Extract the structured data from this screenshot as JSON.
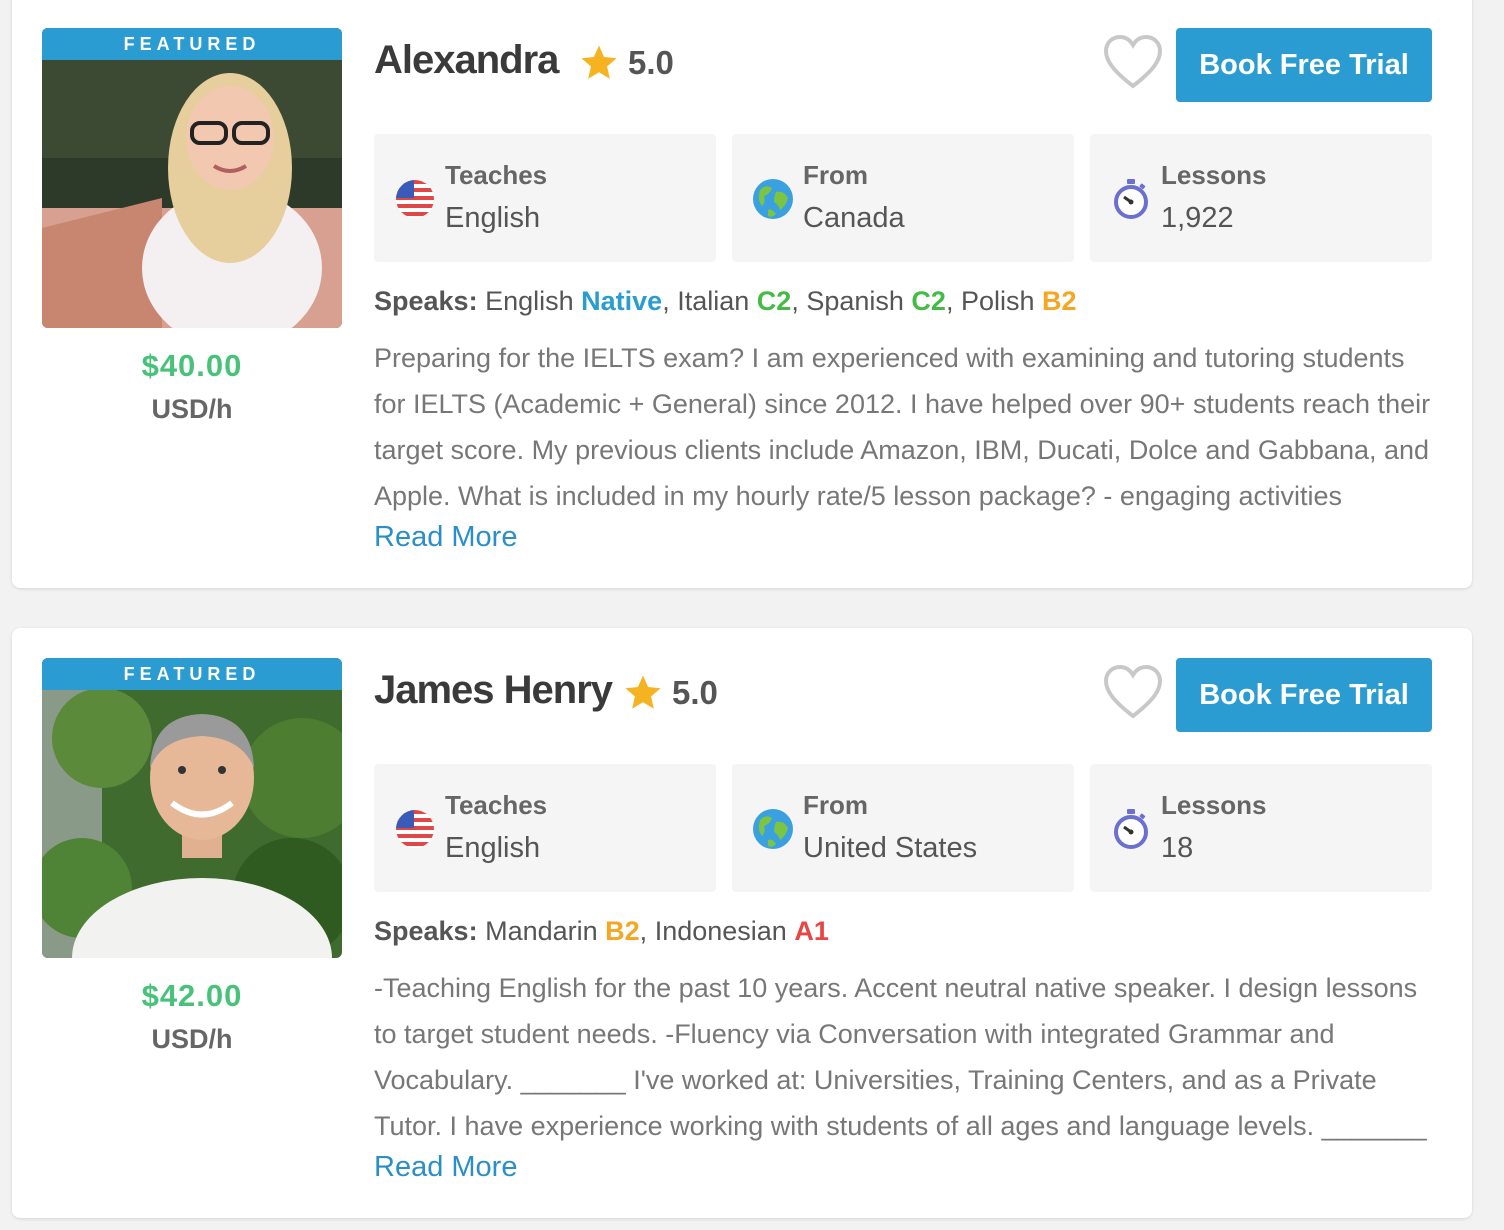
{
  "colors": {
    "accent": "#2a9cd1",
    "price_green": "#48c27a",
    "native": "#2a9cd1",
    "c2": "#44bb44",
    "b2": "#f5a623",
    "a1": "#e84545",
    "star": "#f5b321"
  },
  "icons": {
    "favorite": "heart-icon",
    "rating": "star-icon",
    "teaches": "us-flag-icon",
    "from": "globe-icon",
    "lessons": "stopwatch-icon"
  },
  "tutors": [
    {
      "badge": "FEATURED",
      "name": "Alexandra",
      "rating": "5.0",
      "book_label": "Book Free Trial",
      "price": "$40.00",
      "unit": "USD/h",
      "stats": {
        "teaches_label": "Teaches",
        "teaches_value": "English",
        "from_label": "From",
        "from_value": "Canada",
        "lessons_label": "Lessons",
        "lessons_value": "1,922"
      },
      "speaks_label": "Speaks:",
      "languages": [
        {
          "name": "English",
          "level": "Native",
          "color": "#2a9cd1"
        },
        {
          "name": "Italian",
          "level": "C2",
          "color": "#44bb44"
        },
        {
          "name": "Spanish",
          "level": "C2",
          "color": "#44bb44"
        },
        {
          "name": "Polish",
          "level": "B2",
          "color": "#f5a623"
        }
      ],
      "bio": "Preparing for the IELTS exam? I am experienced with examining and tutoring students for IELTS (Academic + General) since 2012. I have helped over 90+ students reach their target score. My previous clients include Amazon, IBM, Ducati, Dolce and Gabbana, and Apple. What is included in my hourly rate/5 lesson package? - engaging activities",
      "read_more": "Read More"
    },
    {
      "badge": "FEATURED",
      "name": "James Henry",
      "rating": "5.0",
      "book_label": "Book Free Trial",
      "price": "$42.00",
      "unit": "USD/h",
      "stats": {
        "teaches_label": "Teaches",
        "teaches_value": "English",
        "from_label": "From",
        "from_value": "United States",
        "lessons_label": "Lessons",
        "lessons_value": "18"
      },
      "speaks_label": "Speaks:",
      "languages": [
        {
          "name": "Mandarin",
          "level": "B2",
          "color": "#f5a623"
        },
        {
          "name": "Indonesian",
          "level": "A1",
          "color": "#e84545"
        }
      ],
      "bio": "-Teaching English for the past 10 years. Accent neutral native speaker. I design lessons to target student needs. -Fluency via Conversation with integrated Grammar and Vocabulary. _______ I've worked at: Universities, Training Centers, and as a Private Tutor. I have experience working with students of all ages and language levels. _______",
      "read_more": "Read More"
    }
  ]
}
